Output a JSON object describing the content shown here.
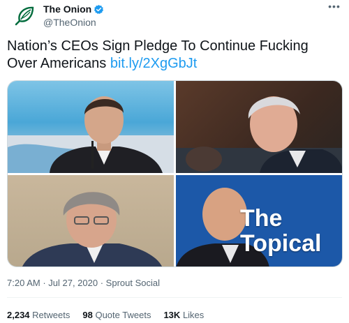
{
  "account": {
    "display_name": "The Onion",
    "handle": "@TheOnion",
    "verified": true,
    "avatar_icon": "onion-logo-icon",
    "brand_color": "#006b3c"
  },
  "tweet": {
    "text": "Nation’s CEOs Sign Pledge To Continue Fucking Over Americans ",
    "link": "bit.ly/2XgGbJt",
    "media_overlay_line1": "The",
    "media_overlay_line2": "Topical"
  },
  "meta": {
    "time": "7:20 AM",
    "separator": " · ",
    "date": "Jul 27, 2020",
    "source": "Sprout Social"
  },
  "stats": {
    "retweets_count": "2,234",
    "retweets_label": "Retweets",
    "quotes_count": "98",
    "quotes_label": "Quote Tweets",
    "likes_count": "13K",
    "likes_label": "Likes"
  },
  "colors": {
    "link": "#1d9bf0",
    "text": "#0f1419",
    "muted": "#536471",
    "topical_bg": "#1c58a8"
  }
}
